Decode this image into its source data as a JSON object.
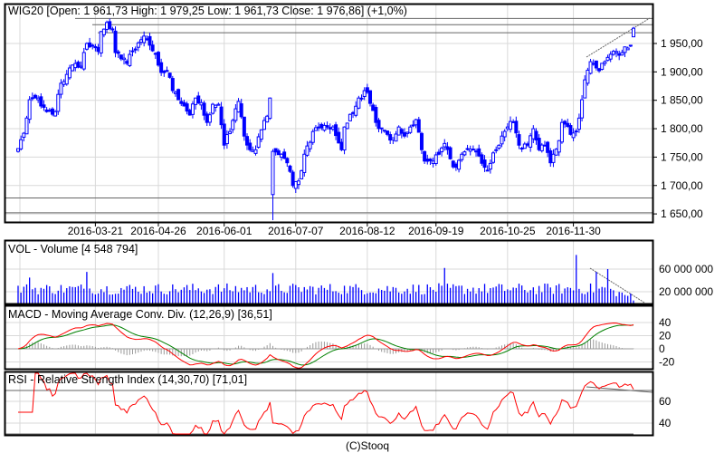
{
  "chart_data": [
    {
      "type": "candlestick",
      "title": "WIG20 [Open: 1 961,73  High: 1 979,25  Low: 1 961,73  Close: 1 976,86] (+1,0%)",
      "last_candle": {
        "open": 1961.73,
        "high": 1979.25,
        "low": 1961.73,
        "close": 1976.86,
        "change": "+1,0%"
      },
      "ylim": [
        1630,
        1995
      ],
      "y_ticks": [
        1950,
        1900,
        1850,
        1800,
        1750,
        1700,
        1650
      ],
      "y_tick_labels": [
        "1 950,00",
        "1 900,00",
        "1 850,00",
        "1 800,00",
        "1 750,00",
        "1 700,00",
        "1 650,00"
      ],
      "x_tick_labels": [
        "2016-03-21",
        "2016-04-26",
        "2016-06-01",
        "2016-07-07",
        "2016-08-12",
        "2016-09-19",
        "2016-10-25",
        "2016-11-30"
      ],
      "x_tick_days": [
        27,
        49,
        72,
        97,
        122,
        146,
        171,
        194
      ],
      "trading_days": 216,
      "close_keypoints": [
        [
          0,
          1765
        ],
        [
          2,
          1792
        ],
        [
          4,
          1851
        ],
        [
          6,
          1854
        ],
        [
          8,
          1840
        ],
        [
          10,
          1830
        ],
        [
          13,
          1830
        ],
        [
          15,
          1880
        ],
        [
          16,
          1883
        ],
        [
          19,
          1912
        ],
        [
          22,
          1910
        ],
        [
          24,
          1950
        ],
        [
          26,
          1947
        ],
        [
          28,
          1936
        ],
        [
          29,
          1971
        ],
        [
          31,
          1987
        ],
        [
          33,
          1974
        ],
        [
          34,
          1934
        ],
        [
          36,
          1923
        ],
        [
          38,
          1915
        ],
        [
          40,
          1937
        ],
        [
          42,
          1951
        ],
        [
          44,
          1963
        ],
        [
          46,
          1947
        ],
        [
          48,
          1931
        ],
        [
          50,
          1899
        ],
        [
          52,
          1902
        ],
        [
          54,
          1867
        ],
        [
          56,
          1851
        ],
        [
          58,
          1840
        ],
        [
          60,
          1824
        ],
        [
          62,
          1854
        ],
        [
          64,
          1846
        ],
        [
          66,
          1811
        ],
        [
          68,
          1843
        ],
        [
          70,
          1843
        ],
        [
          72,
          1771
        ],
        [
          74,
          1795
        ],
        [
          76,
          1835
        ],
        [
          77,
          1848
        ],
        [
          79,
          1787
        ],
        [
          81,
          1763
        ],
        [
          83,
          1763
        ],
        [
          85,
          1798
        ],
        [
          87,
          1822
        ],
        [
          88,
          1854
        ],
        [
          89,
          1684
        ],
        [
          90,
          1759
        ],
        [
          92,
          1755
        ],
        [
          94,
          1740
        ],
        [
          96,
          1700
        ],
        [
          98,
          1708
        ],
        [
          100,
          1755
        ],
        [
          103,
          1795
        ],
        [
          105,
          1803
        ],
        [
          108,
          1803
        ],
        [
          110,
          1803
        ],
        [
          113,
          1763
        ],
        [
          114,
          1803
        ],
        [
          117,
          1827
        ],
        [
          119,
          1854
        ],
        [
          121,
          1867
        ],
        [
          122,
          1864
        ],
        [
          124,
          1832
        ],
        [
          125,
          1811
        ],
        [
          127,
          1800
        ],
        [
          129,
          1790
        ],
        [
          131,
          1784
        ],
        [
          133,
          1803
        ],
        [
          135,
          1787
        ],
        [
          137,
          1803
        ],
        [
          139,
          1816
        ],
        [
          141,
          1763
        ],
        [
          142,
          1743
        ],
        [
          145,
          1743
        ],
        [
          147,
          1755
        ],
        [
          149,
          1774
        ],
        [
          151,
          1747
        ],
        [
          153,
          1732
        ],
        [
          155,
          1755
        ],
        [
          157,
          1765
        ],
        [
          159,
          1763
        ],
        [
          161,
          1752
        ],
        [
          163,
          1732
        ],
        [
          164,
          1727
        ],
        [
          167,
          1763
        ],
        [
          169,
          1787
        ],
        [
          171,
          1803
        ],
        [
          173,
          1811
        ],
        [
          175,
          1771
        ],
        [
          178,
          1771
        ],
        [
          180,
          1800
        ],
        [
          182,
          1763
        ],
        [
          184,
          1771
        ],
        [
          186,
          1740
        ],
        [
          187,
          1755
        ],
        [
          189,
          1779
        ],
        [
          190,
          1811
        ],
        [
          193,
          1790
        ],
        [
          195,
          1795
        ],
        [
          197,
          1851
        ],
        [
          198,
          1886
        ],
        [
          200,
          1918
        ],
        [
          202,
          1907
        ],
        [
          203,
          1902
        ],
        [
          205,
          1918
        ],
        [
          207,
          1931
        ],
        [
          209,
          1936
        ],
        [
          211,
          1934
        ],
        [
          213,
          1942
        ],
        [
          214,
          1947
        ],
        [
          215,
          1976.86
        ]
      ],
      "crash_low": {
        "day": 89,
        "low": 1639
      },
      "horizontal_levels": [
        1994,
        1983,
        1969,
        1678,
        1652
      ]
    },
    {
      "type": "bar",
      "title": "VOL - Volume [4 548 794]",
      "y_ticks": [
        60000000,
        20000000
      ],
      "y_tick_labels": [
        "60 000 000",
        "20 000 000"
      ],
      "typical_volume": 25000000,
      "peaks": [
        [
          4,
          45000000
        ],
        [
          24,
          55000000
        ],
        [
          89,
          53000000
        ],
        [
          149,
          62000000
        ],
        [
          195,
          85000000
        ],
        [
          202,
          55000000
        ],
        [
          206,
          60000000
        ]
      ],
      "last_value": 4548794
    },
    {
      "type": "line",
      "title": "MACD - Moving Average Conv. Div. (12,26,9) [36,51]",
      "params": [
        12,
        26,
        9
      ],
      "last_value": 36.51,
      "y_ticks": [
        40,
        20,
        0,
        -20
      ],
      "y_tick_labels": [
        "40",
        "20",
        "0",
        "-20"
      ],
      "series": [
        {
          "name": "MACD",
          "color": "#ff0000"
        },
        {
          "name": "Signal",
          "color": "#008000"
        },
        {
          "name": "Histogram",
          "color": "#999999"
        }
      ]
    },
    {
      "type": "line",
      "title": "RSI - Relative Strength Index (14,30,70) [71,01]",
      "params": [
        14,
        30,
        70
      ],
      "last_value": 71.01,
      "y_ticks": [
        60,
        40
      ],
      "y_tick_labels": [
        "60",
        "40"
      ],
      "series": [
        {
          "name": "RSI",
          "color": "#ff0000"
        }
      ]
    }
  ],
  "footer": "(C)Stooq",
  "colors": {
    "candle": "#0000ff",
    "grid": "#d9d9d9",
    "trend": "#666666",
    "macd": "#ff0000",
    "signal": "#008000",
    "hist": "#999999"
  }
}
